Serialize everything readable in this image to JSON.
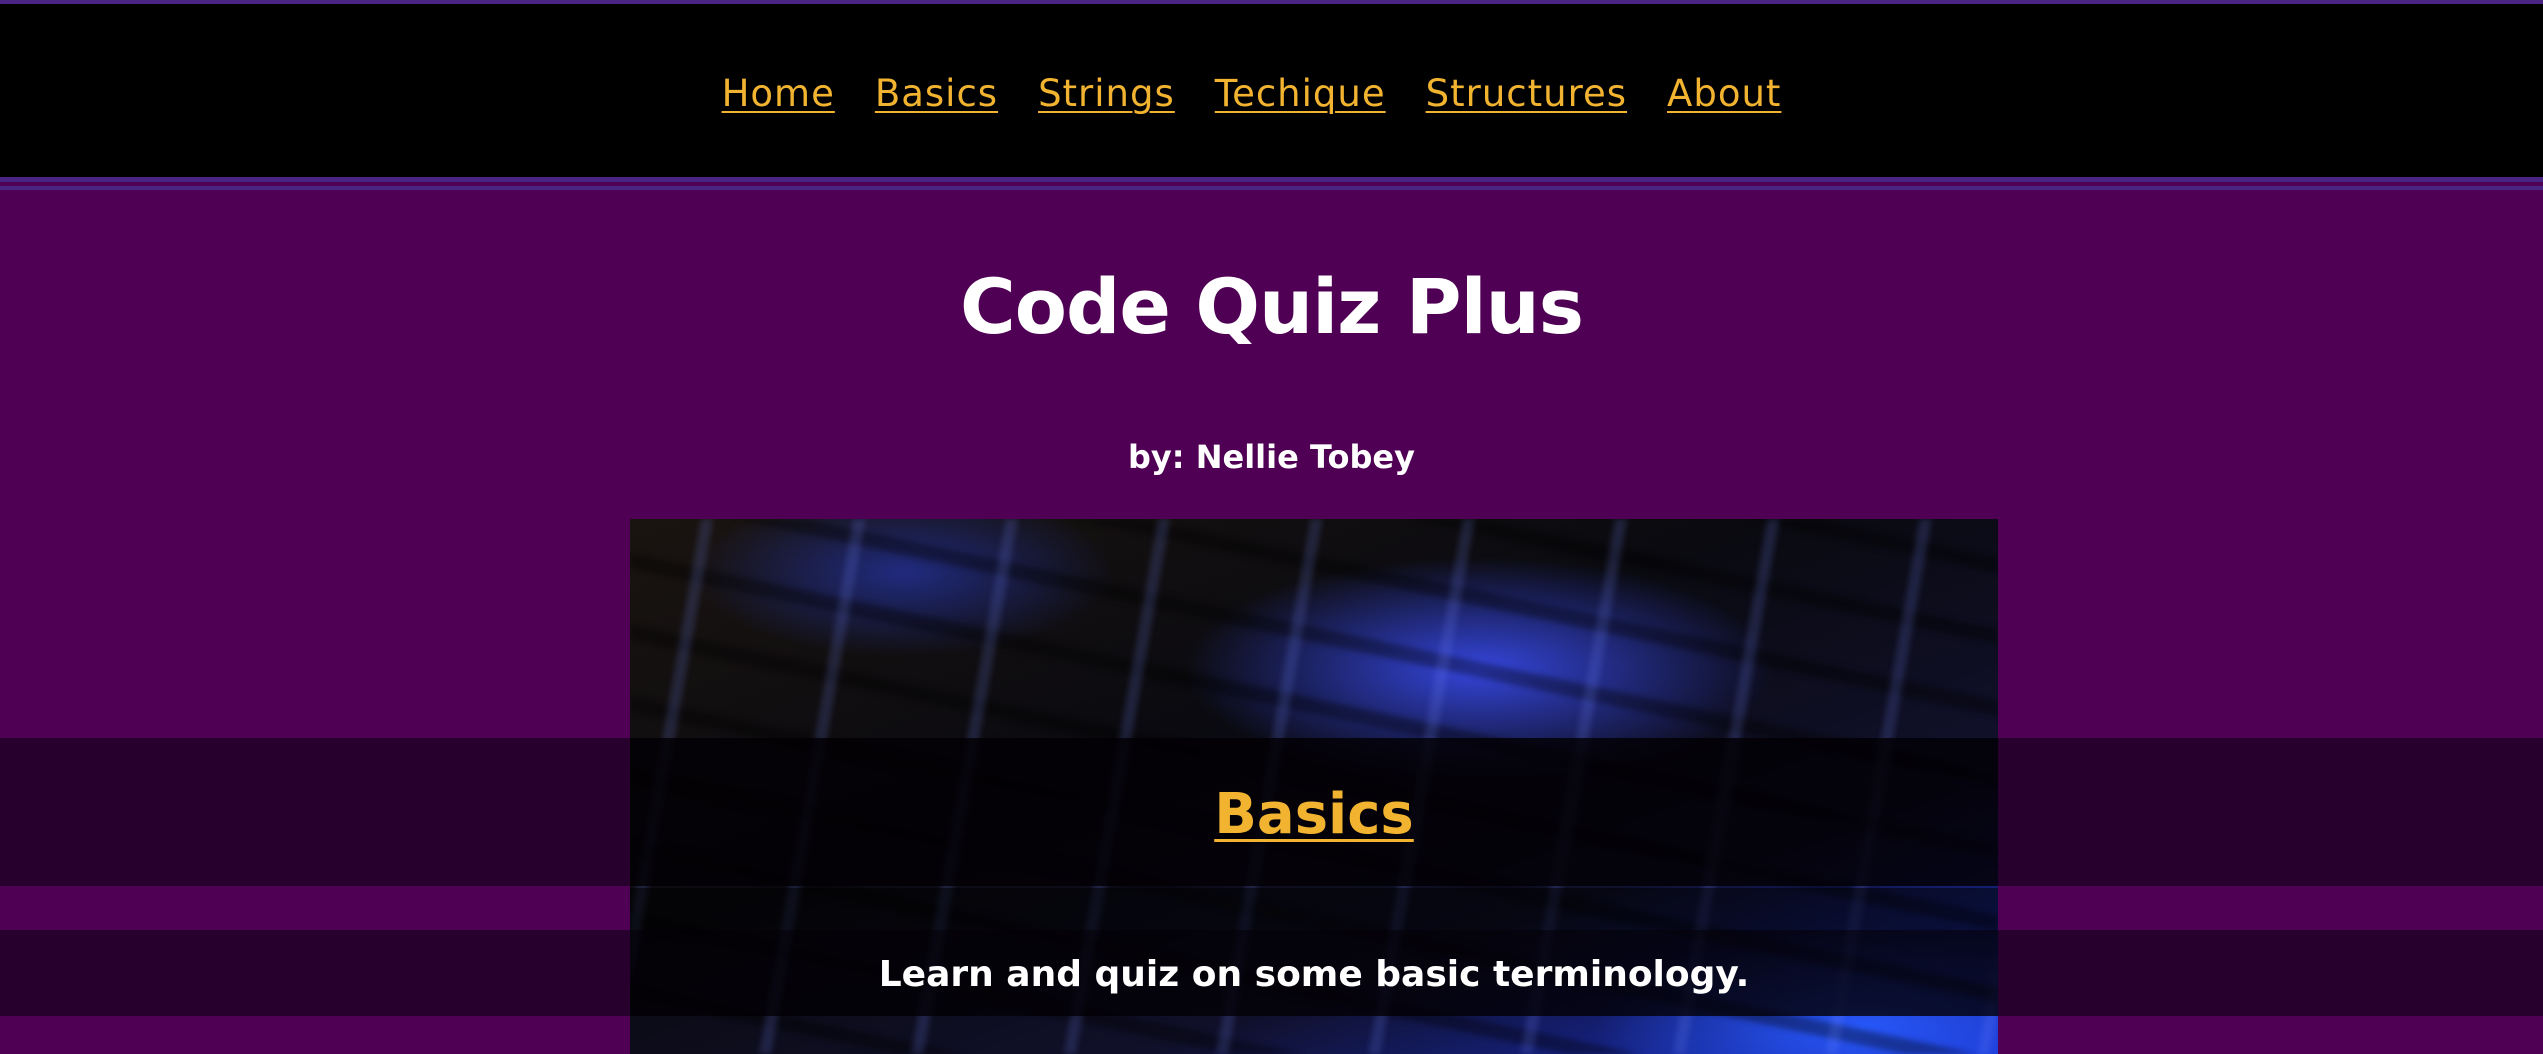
{
  "nav": {
    "items": [
      {
        "label": "Home"
      },
      {
        "label": "Basics"
      },
      {
        "label": "Strings"
      },
      {
        "label": "Techique"
      },
      {
        "label": "Structures"
      },
      {
        "label": "About"
      }
    ]
  },
  "header": {
    "title": "Code Quiz Plus",
    "byline": "by: Nellie Tobey"
  },
  "card": {
    "title": "Basics",
    "description": "Learn and quiz on some basic terminology."
  },
  "colors": {
    "background": "#4f0054",
    "nav_bar": "#000000",
    "accent_rule": "#4a2482",
    "link": "#f2b430",
    "text": "#ffffff"
  }
}
